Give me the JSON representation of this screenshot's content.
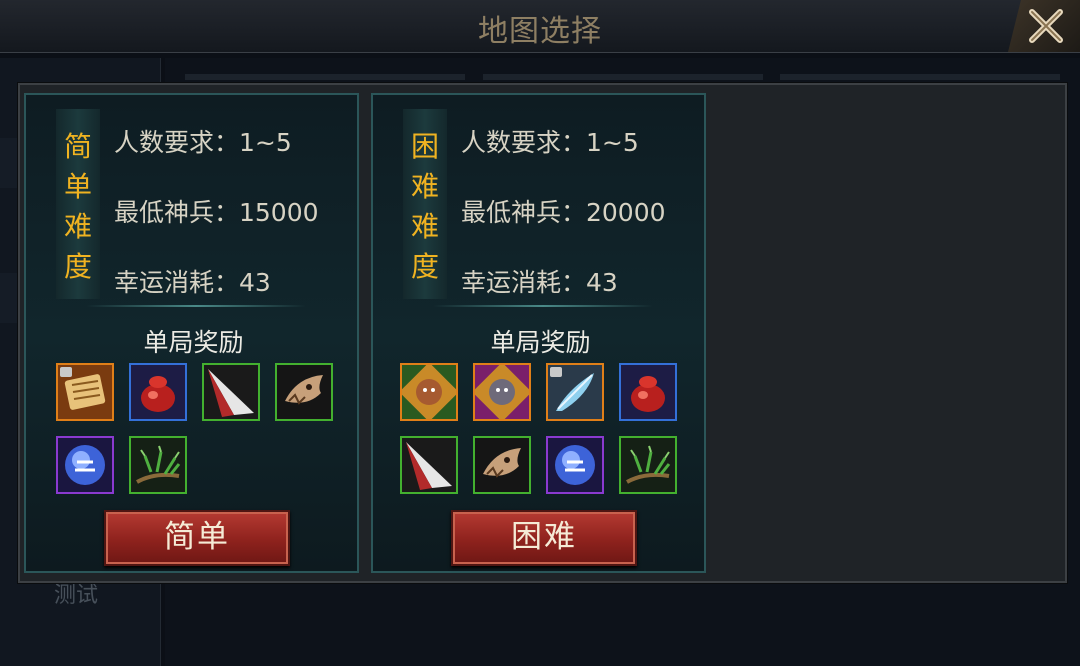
{
  "window": {
    "title": "地图选择"
  },
  "background": {
    "ghost_text": "测试"
  },
  "cards": [
    {
      "difficulty_label": "简单难度",
      "stats": {
        "players": "人数要求：1~5",
        "min_power": "最低神兵：15000",
        "luck_cost": "幸运消耗：43"
      },
      "reward_title": "单局奖励",
      "rewards": [
        {
          "icon": "scroll-icon",
          "quality": "orange",
          "locked": true
        },
        {
          "icon": "red-pouch-icon",
          "quality": "blue",
          "locked": false
        },
        {
          "icon": "blade-shard-icon",
          "quality": "green",
          "locked": false
        },
        {
          "icon": "beast-skull-icon",
          "quality": "green",
          "locked": false
        },
        {
          "icon": "blue-orb-icon",
          "quality": "purple",
          "locked": false
        },
        {
          "icon": "herb-branch-icon",
          "quality": "green",
          "locked": false
        }
      ],
      "button_label": "简单"
    },
    {
      "difficulty_label": "困难难度",
      "stats": {
        "players": "人数要求：1~5",
        "min_power": "最低神兵：20000",
        "luck_cost": "幸运消耗：43"
      },
      "reward_title": "单局奖励",
      "rewards": [
        {
          "icon": "monkey-king-card-icon",
          "quality": "orange",
          "locked": false
        },
        {
          "icon": "warrior-card-icon",
          "quality": "orange",
          "locked": false
        },
        {
          "icon": "blue-feather-icon",
          "quality": "orange",
          "locked": true
        },
        {
          "icon": "red-pouch-icon",
          "quality": "blue",
          "locked": false
        },
        {
          "icon": "blade-shard-icon",
          "quality": "green",
          "locked": false
        },
        {
          "icon": "beast-skull-icon",
          "quality": "green",
          "locked": false
        },
        {
          "icon": "blue-orb-icon",
          "quality": "purple",
          "locked": false
        },
        {
          "icon": "herb-branch-icon",
          "quality": "green",
          "locked": false
        }
      ],
      "button_label": "困难"
    }
  ],
  "colors": {
    "difficulty_text": "#f0b321",
    "card_border": "#2b5659",
    "button_red": "#a52d27"
  }
}
